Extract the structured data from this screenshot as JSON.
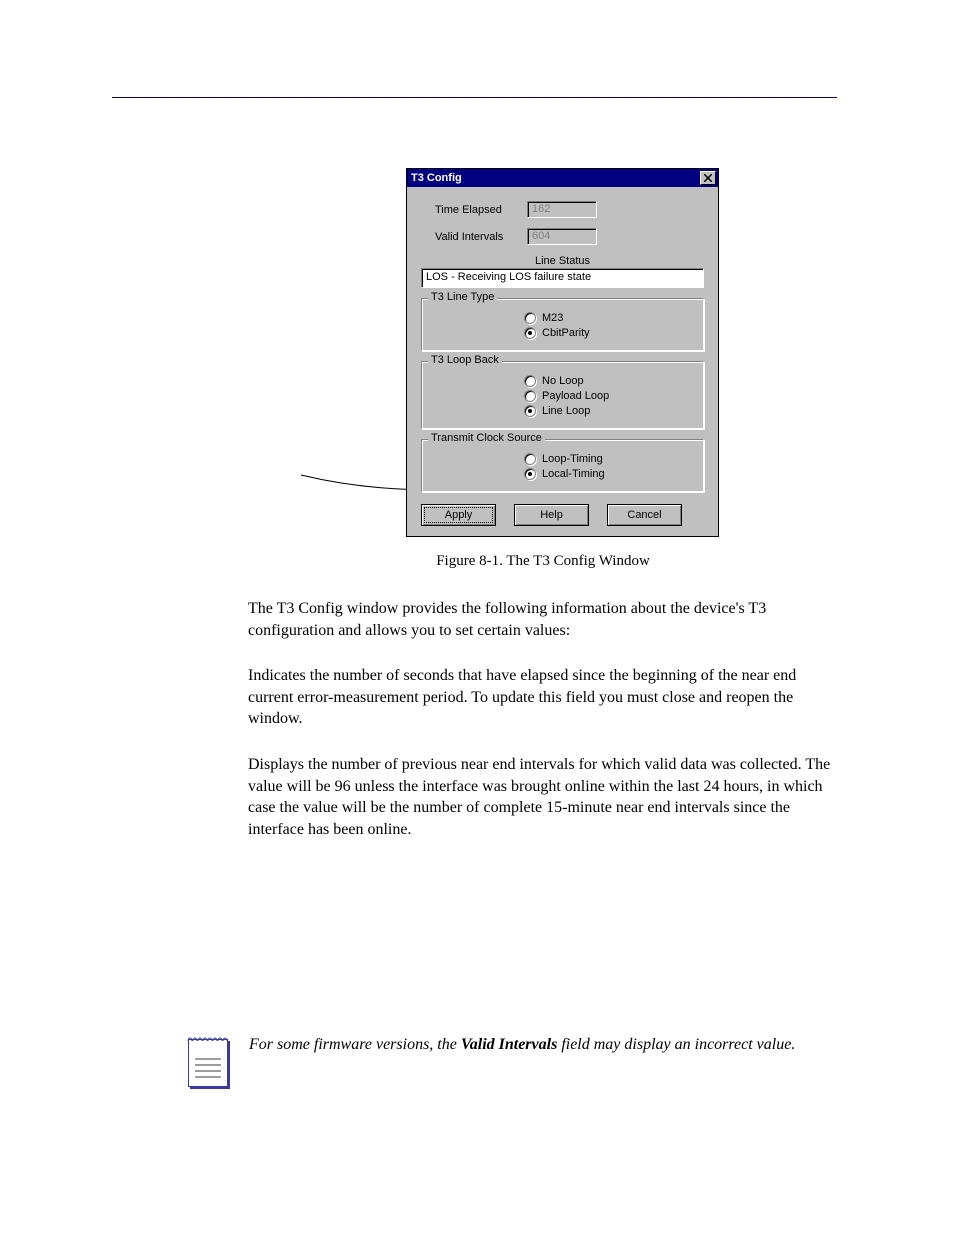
{
  "dialog": {
    "title": "T3 Config",
    "fields": {
      "time_elapsed_label": "Time Elapsed",
      "time_elapsed_value": "162",
      "valid_intervals_label": "Valid Intervals",
      "valid_intervals_value": "604"
    },
    "line_status": {
      "caption": "Line Status",
      "value": "LOS - Receiving LOS failure state"
    },
    "groups": {
      "line_type": {
        "legend": "T3 Line Type",
        "options": [
          "M23",
          "CbitParity"
        ],
        "selected": 1
      },
      "loop_back": {
        "legend": "T3 Loop Back",
        "options": [
          "No Loop",
          "Payload Loop",
          "Line Loop"
        ],
        "selected": 2
      },
      "clock": {
        "legend": "Transmit Clock Source",
        "options": [
          "Loop-Timing",
          "Local-Timing"
        ],
        "selected": 1
      }
    },
    "buttons": {
      "apply": "Apply",
      "help": "Help",
      "cancel": "Cancel"
    }
  },
  "figure_caption": "Figure 8-1.  The T3 Config Window",
  "paragraphs": {
    "intro": "The T3 Config window provides the following information about the device's T3 configuration and allows you to set certain values:",
    "time_elapsed": "Indicates the number of seconds that have elapsed since the beginning of the near end current error-measurement period. To update this field you must close and reopen the window.",
    "valid_intervals": "Displays the number of previous near end intervals for which valid data was collected. The value will be 96 unless the interface was brought online within the last 24 hours, in which case the value will be the number of complete 15-minute near end intervals since the interface has been online."
  },
  "note": {
    "pre": "For some firmware versions, the ",
    "bold": "Valid Intervals",
    "post": " field may display an incorrect value."
  }
}
